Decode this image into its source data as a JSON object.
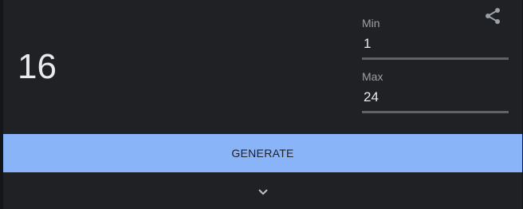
{
  "result": {
    "value": "16"
  },
  "min": {
    "label": "Min",
    "value": "1"
  },
  "max": {
    "label": "Max",
    "value": "24"
  },
  "generate": {
    "label": "GENERATE"
  },
  "icons": {
    "share": "share-icon",
    "expand": "chevron-down-icon"
  },
  "colors": {
    "card_bg": "#202124",
    "button_bg": "#8ab4f8",
    "text": "#e8eaed",
    "label": "#9aa0a6",
    "underline": "#5f6368"
  }
}
